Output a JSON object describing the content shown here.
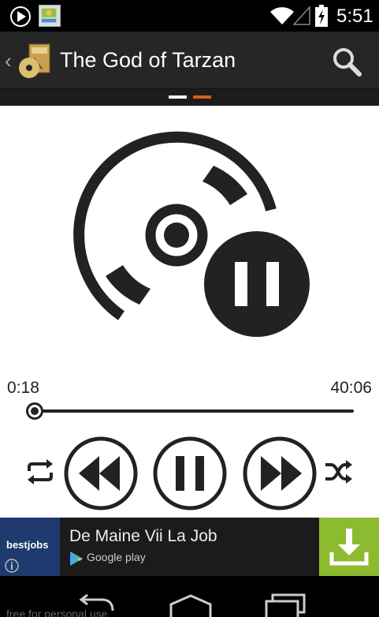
{
  "status_bar": {
    "time": "5:51",
    "icons": [
      "play-store-notification-icon",
      "app-notification-icon",
      "wifi-icon",
      "signal-icon",
      "battery-charging-icon"
    ]
  },
  "action_bar": {
    "title": "The God of Tarzan",
    "icons": [
      "up-caret-icon",
      "book-cd-app-icon",
      "search-icon"
    ]
  },
  "pager": {
    "page_count": 2,
    "active_page": 2
  },
  "player": {
    "elapsed": "0:18",
    "duration": "40:06",
    "progress": 0.0075,
    "state": "playing",
    "controls": [
      "repeat-icon",
      "rewind-icon",
      "pause-icon",
      "fast-forward-icon",
      "shuffle-icon"
    ]
  },
  "ad": {
    "brand": "bestjobs",
    "title": "De Maine Vii La Job",
    "store": "Google play",
    "icons": [
      "info-icon",
      "google-play-icon",
      "download-icon"
    ]
  },
  "nav_bar": {
    "watermark": "free for personal use",
    "icons": [
      "back-icon",
      "home-icon",
      "recents-icon"
    ]
  },
  "colors": {
    "accent": "#e05a1a",
    "action_bar": "#262626",
    "ad_download": "#8dbb2f",
    "ad_logo_bg": "#1e3a6e"
  }
}
